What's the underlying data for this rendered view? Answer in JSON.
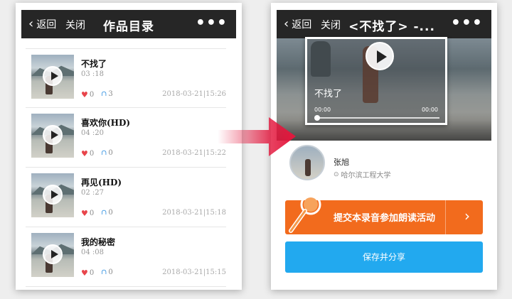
{
  "left_screen": {
    "nav": {
      "back_label": "返回",
      "close_label": "关闭",
      "title": "作品目录",
      "more_label": "•••"
    },
    "items": [
      {
        "title": "不找了",
        "duration": "03 :18",
        "likes": "0",
        "listens": "3",
        "date": "2018-03-21|15:26"
      },
      {
        "title": "喜欢你(HD)",
        "duration": "04 :20",
        "likes": "0",
        "listens": "0",
        "date": "2018-03-21|15:22"
      },
      {
        "title": "再见(HD)",
        "duration": "02 :27",
        "likes": "0",
        "listens": "0",
        "date": "2018-03-21|15:18"
      },
      {
        "title": "我的秘密",
        "duration": "04 :08",
        "likes": "0",
        "listens": "0",
        "date": "2018-03-21|15:15"
      }
    ]
  },
  "right_screen": {
    "nav": {
      "back_label": "返回",
      "close_label": "关闭",
      "title": "<不找了> -...",
      "more_label": "•••"
    },
    "video": {
      "caption": "不找了",
      "current_time": "00:00",
      "total_time": "00:00"
    },
    "author": {
      "name": "张旭",
      "school": "哈尔滨工程大学"
    },
    "submit_button": {
      "label": "提交本录音参加朗读活动",
      "chevron": "›"
    },
    "share_button": {
      "label": "保存并分享"
    }
  },
  "colors": {
    "nav_bg": "#262626",
    "orange": "#f26b1d",
    "blue": "#22a9ef",
    "like": "#e8454b",
    "listen": "#2d8ee0",
    "arrow": "#e3173d"
  }
}
